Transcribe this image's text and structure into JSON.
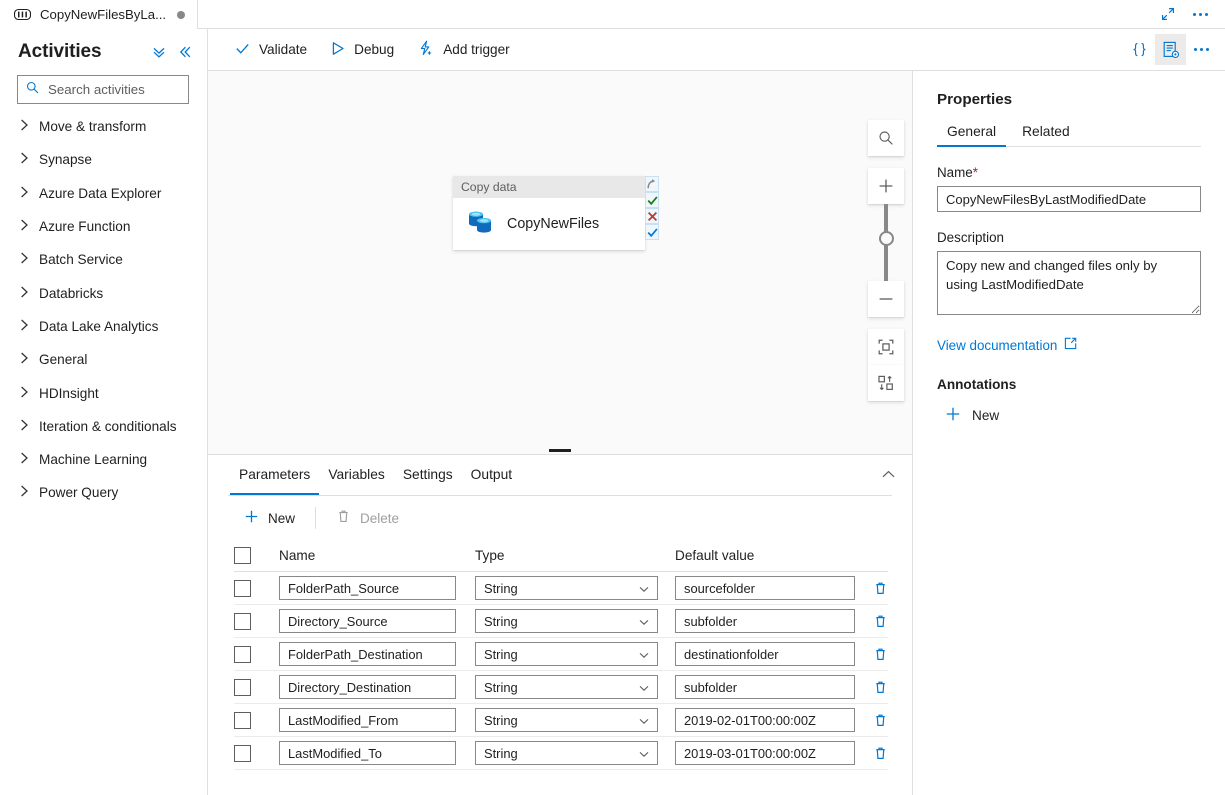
{
  "titlebar": {
    "tab": {
      "icon": "pipeline-icon",
      "label": "CopyNewFilesByLa...",
      "unsaved_dot": true
    },
    "actions": [
      {
        "name": "expand-icon",
        "label": "Expand"
      },
      {
        "name": "more-menu-icon",
        "label": "More"
      }
    ]
  },
  "activities": {
    "title": "Activities",
    "collapse_all_label": "Collapse all",
    "collapse_panel_label": "Collapse panel",
    "search": {
      "placeholder": "Search activities",
      "value": ""
    },
    "items": [
      {
        "label": "Move & transform"
      },
      {
        "label": "Synapse"
      },
      {
        "label": "Azure Data Explorer"
      },
      {
        "label": "Azure Function"
      },
      {
        "label": "Batch Service"
      },
      {
        "label": "Databricks"
      },
      {
        "label": "Data Lake Analytics"
      },
      {
        "label": "General"
      },
      {
        "label": "HDInsight"
      },
      {
        "label": "Iteration & conditionals"
      },
      {
        "label": "Machine Learning"
      },
      {
        "label": "Power Query"
      }
    ]
  },
  "toolbar": {
    "validate_label": "Validate",
    "debug_label": "Debug",
    "add_trigger_label": "Add trigger",
    "code_label": "Code",
    "properties_label": "Properties",
    "more_label": "More"
  },
  "canvas": {
    "node": {
      "type_label": "Copy data",
      "name": "CopyNewFiles",
      "icon": "copy-data-icon",
      "ports": [
        {
          "name": "port-skipped",
          "glyph": "skipped-arrow"
        },
        {
          "name": "port-success",
          "glyph": "green-check"
        },
        {
          "name": "port-failure",
          "glyph": "red-x"
        },
        {
          "name": "port-completion",
          "glyph": "blue-check"
        }
      ]
    },
    "zoom_controls": [
      {
        "name": "zoom-search-icon",
        "label": "Search canvas"
      },
      {
        "name": "zoom-in-icon",
        "label": "Zoom in"
      },
      {
        "name": "zoom-slider",
        "label": "Zoom level"
      },
      {
        "name": "zoom-out-icon",
        "label": "Zoom out"
      },
      {
        "name": "zoom-to-fit-icon",
        "label": "Zoom to fit"
      },
      {
        "name": "auto-align-icon",
        "label": "Auto align"
      }
    ]
  },
  "bottom_panel": {
    "tabs": [
      {
        "label": "Parameters",
        "active": true
      },
      {
        "label": "Variables",
        "active": false
      },
      {
        "label": "Settings",
        "active": false
      },
      {
        "label": "Output",
        "active": false
      }
    ],
    "collapse_label": "Collapse",
    "commands": {
      "new_label": "New",
      "delete_label": "Delete"
    },
    "columns": [
      "Name",
      "Type",
      "Default value"
    ],
    "rows": [
      {
        "name": "FolderPath_Source",
        "type": "String",
        "default": "sourcefolder"
      },
      {
        "name": "Directory_Source",
        "type": "String",
        "default": "subfolder"
      },
      {
        "name": "FolderPath_Destination",
        "type": "String",
        "default": "destinationfolder"
      },
      {
        "name": "Directory_Destination",
        "type": "String",
        "default": "subfolder"
      },
      {
        "name": "LastModified_From",
        "type": "String",
        "default": "2019-02-01T00:00:00Z"
      },
      {
        "name": "LastModified_To",
        "type": "String",
        "default": "2019-03-01T00:00:00Z"
      }
    ]
  },
  "properties": {
    "title": "Properties",
    "tabs": [
      {
        "label": "General",
        "active": true
      },
      {
        "label": "Related",
        "active": false
      }
    ],
    "name_label": "Name",
    "name_required": "*",
    "name_value": "CopyNewFilesByLastModifiedDate",
    "description_label": "Description",
    "description_value": "Copy new and changed files only by using LastModifiedDate",
    "doc_link_label": "View documentation",
    "annotations_label": "Annotations",
    "annotation_new_label": "New"
  },
  "colors": {
    "accent": "#0078d4",
    "border": "#e1dfdd",
    "canvas_bg": "#fafafa",
    "success": "#107c10",
    "error": "#a4262c",
    "text": "#201f1e"
  }
}
